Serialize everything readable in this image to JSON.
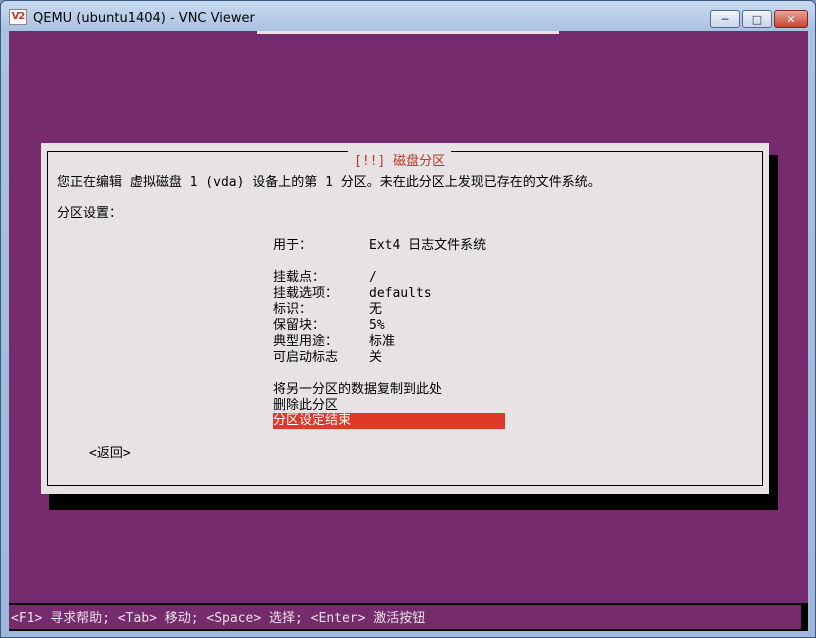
{
  "window": {
    "title": "QEMU (ubuntu1404) - VNC Viewer",
    "icon_text": "V2",
    "controls": {
      "min": "─",
      "max": "□",
      "close": "✕"
    }
  },
  "dialog": {
    "title": "[!!] 磁盘分区",
    "description": "您正在编辑 虚拟磁盘 1 (vda) 设备上的第 1 分区。未在此分区上发现已存在的文件系统。",
    "section_label": "分区设置：",
    "settings": [
      {
        "label": "用于：",
        "value": "Ext4 日志文件系统"
      },
      {
        "label": "挂载点：",
        "value": "/"
      },
      {
        "label": "挂载选项：",
        "value": "defaults"
      },
      {
        "label": "标识：",
        "value": "无"
      },
      {
        "label": "保留块：",
        "value": "5%"
      },
      {
        "label": "典型用途：",
        "value": "标准"
      },
      {
        "label": "可启动标志",
        "value": "关"
      }
    ],
    "actions": [
      {
        "label": "将另一分区的数据复制到此处"
      },
      {
        "label": "删除此分区"
      },
      {
        "label": "分区设定结束",
        "selected": true
      }
    ],
    "back_button": "<返回>"
  },
  "status_bar": "<F1> 寻求帮助; <Tab> 移动; <Space> 选择; <Enter> 激活按钮",
  "colors": {
    "background": "#772b6f",
    "dialog": "#e7e3e5",
    "title_red": "#c2332a",
    "highlight": "#de3a27"
  }
}
